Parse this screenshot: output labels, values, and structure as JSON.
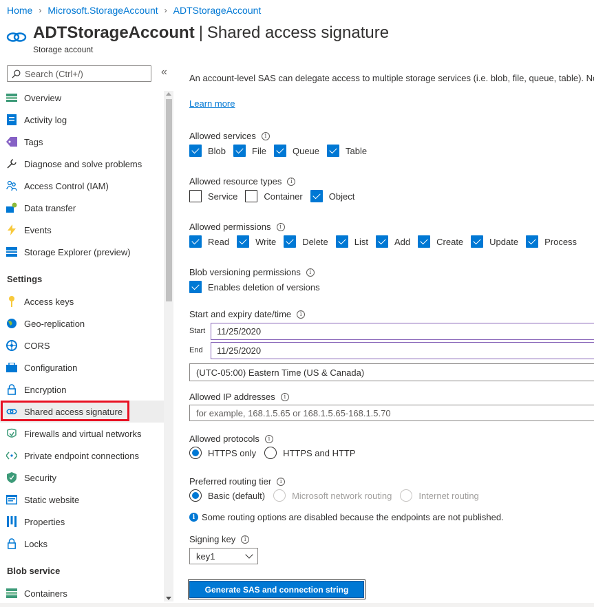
{
  "breadcrumb": {
    "items": [
      "Home",
      "Microsoft.StorageAccount",
      "ADTStorageAccount"
    ],
    "sep": "›"
  },
  "header": {
    "resource": "ADTStorageAccount",
    "page": "Shared access signature",
    "pipe": "|",
    "subtitle": "Storage account"
  },
  "sidebar": {
    "search_placeholder": "Search (Ctrl+/)",
    "collapse": "«",
    "items": [
      {
        "label": "Overview",
        "icon": "overview-icon"
      },
      {
        "label": "Activity log",
        "icon": "activity-log-icon"
      },
      {
        "label": "Tags",
        "icon": "tag-icon"
      },
      {
        "label": "Diagnose and solve problems",
        "icon": "wrench-icon"
      },
      {
        "label": "Access Control (IAM)",
        "icon": "people-icon"
      },
      {
        "label": "Data transfer",
        "icon": "data-transfer-icon"
      },
      {
        "label": "Events",
        "icon": "lightning-icon"
      },
      {
        "label": "Storage Explorer (preview)",
        "icon": "storage-explorer-icon"
      }
    ],
    "settings_header": "Settings",
    "settings": [
      {
        "label": "Access keys",
        "icon": "key-icon"
      },
      {
        "label": "Geo-replication",
        "icon": "globe-icon"
      },
      {
        "label": "CORS",
        "icon": "cors-icon"
      },
      {
        "label": "Configuration",
        "icon": "configuration-icon"
      },
      {
        "label": "Encryption",
        "icon": "lock-icon"
      },
      {
        "label": "Shared access signature",
        "icon": "link-icon",
        "active": true
      },
      {
        "label": "Firewalls and virtual networks",
        "icon": "firewall-icon"
      },
      {
        "label": "Private endpoint connections",
        "icon": "endpoint-icon"
      },
      {
        "label": "Security",
        "icon": "shield-icon"
      },
      {
        "label": "Static website",
        "icon": "website-icon"
      },
      {
        "label": "Properties",
        "icon": "properties-icon"
      },
      {
        "label": "Locks",
        "icon": "lock-icon"
      }
    ],
    "blob_header": "Blob service",
    "blob": [
      {
        "label": "Containers",
        "icon": "containers-icon"
      }
    ]
  },
  "main": {
    "description": "An account-level SAS can delegate access to multiple storage services (i.e. blob, file, queue, table). Note",
    "learn_more": "Learn more",
    "info_glyph": "i",
    "allowed_services": {
      "label": "Allowed services",
      "options": [
        {
          "label": "Blob",
          "checked": true
        },
        {
          "label": "File",
          "checked": true
        },
        {
          "label": "Queue",
          "checked": true
        },
        {
          "label": "Table",
          "checked": true
        }
      ]
    },
    "resource_types": {
      "label": "Allowed resource types",
      "options": [
        {
          "label": "Service",
          "checked": false
        },
        {
          "label": "Container",
          "checked": false
        },
        {
          "label": "Object",
          "checked": true
        }
      ]
    },
    "permissions": {
      "label": "Allowed permissions",
      "options": [
        {
          "label": "Read",
          "checked": true
        },
        {
          "label": "Write",
          "checked": true
        },
        {
          "label": "Delete",
          "checked": true
        },
        {
          "label": "List",
          "checked": true
        },
        {
          "label": "Add",
          "checked": true
        },
        {
          "label": "Create",
          "checked": true
        },
        {
          "label": "Update",
          "checked": true
        },
        {
          "label": "Process",
          "checked": true
        }
      ]
    },
    "versioning": {
      "label": "Blob versioning permissions",
      "option": "Enables deletion of versions",
      "checked": true
    },
    "dates": {
      "label": "Start and expiry date/time",
      "start_label": "Start",
      "start": "11/25/2020",
      "end_label": "End",
      "end": "11/25/2020"
    },
    "timezone": "(UTC-05:00) Eastern Time (US & Canada)",
    "ip": {
      "label": "Allowed IP addresses",
      "placeholder": "for example, 168.1.5.65 or 168.1.5.65-168.1.5.70"
    },
    "protocols": {
      "label": "Allowed protocols",
      "options": [
        {
          "label": "HTTPS only",
          "selected": true
        },
        {
          "label": "HTTPS and HTTP",
          "selected": false
        }
      ]
    },
    "routing": {
      "label": "Preferred routing tier",
      "options": [
        {
          "label": "Basic (default)",
          "selected": true,
          "disabled": false
        },
        {
          "label": "Microsoft network routing",
          "selected": false,
          "disabled": true
        },
        {
          "label": "Internet routing",
          "selected": false,
          "disabled": true
        }
      ]
    },
    "notice": "Some routing options are disabled because the endpoints are not published.",
    "signing": {
      "label": "Signing key",
      "value": "key1"
    },
    "generate_button": "Generate SAS and connection string"
  },
  "colors": {
    "accent": "#0078d4",
    "highlight_frame": "#e81123",
    "date_border": "#8764b8"
  }
}
